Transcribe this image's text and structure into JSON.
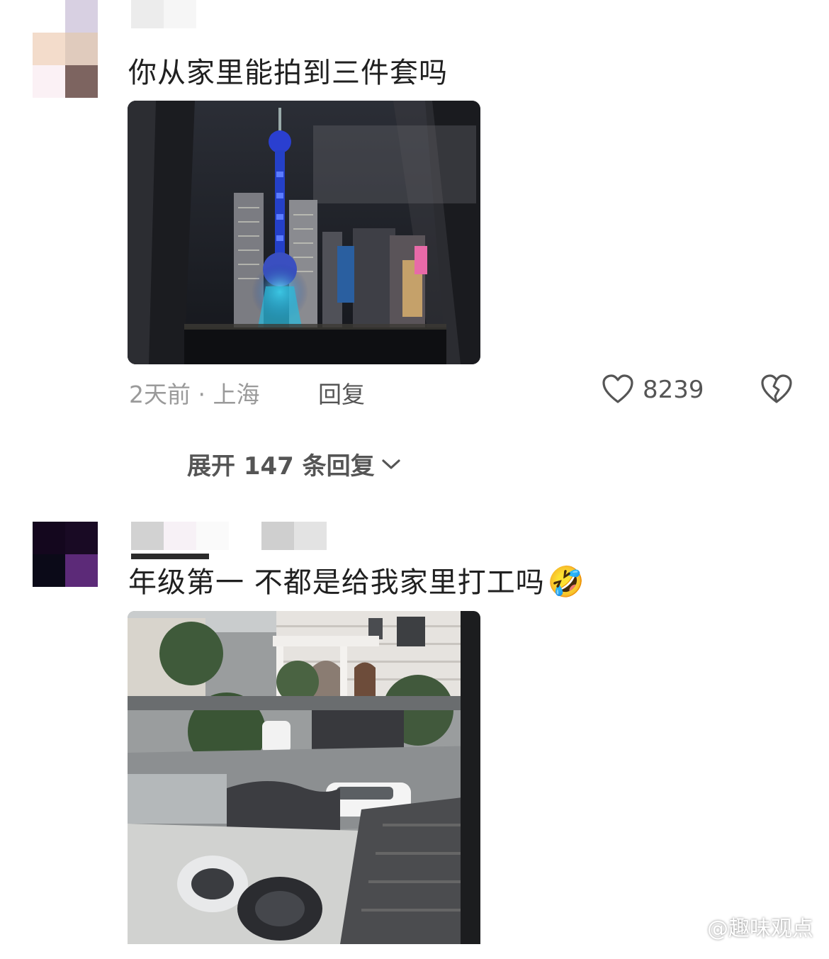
{
  "comments": [
    {
      "text": "你从家里能拍到三件套吗",
      "time_location": "2天前 · 上海",
      "reply_label": "回复",
      "like_count": "8239",
      "expand_label": "展开 147 条回复"
    },
    {
      "text": "年级第一 不都是给我家里打工吗",
      "emoji": "🤣"
    }
  ],
  "watermark": "@趣味观点",
  "colors": {
    "text": "#202020",
    "meta": "#9a9a9a",
    "action": "#555555"
  }
}
